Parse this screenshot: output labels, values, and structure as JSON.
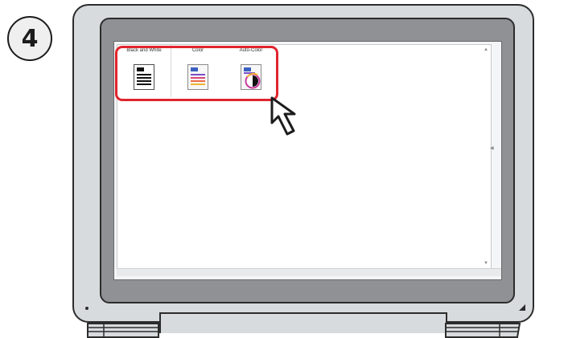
{
  "step": {
    "number": "4"
  },
  "dialog": {
    "options": [
      {
        "label": "Black and White",
        "icon": "document-black-white-icon"
      },
      {
        "label": "Color",
        "icon": "document-color-icon"
      },
      {
        "label": "Auto-Color",
        "icon": "document-auto-color-icon"
      }
    ]
  },
  "colors": {
    "highlight": "#e0242d",
    "bezel": "#8f9194",
    "laptop_body": "#d8dbdd",
    "outline": "#2c2c2c"
  }
}
